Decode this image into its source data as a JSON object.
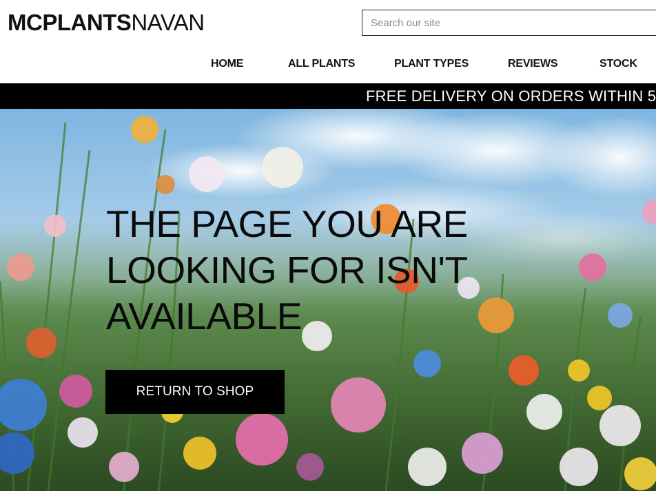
{
  "header": {
    "logo_bold": "MCPLANTS",
    "logo_light": "NAVAN",
    "search_placeholder": "Search our site"
  },
  "nav": {
    "items": [
      "HOME",
      "ALL PLANTS",
      "PLANT TYPES",
      "REVIEWS",
      "STOCK"
    ]
  },
  "banner": {
    "text": "FREE DELIVERY ON ORDERS WITHIN 5"
  },
  "hero": {
    "headline": "THE PAGE YOU ARE LOOKING FOR ISN'T AVAILABLE",
    "button_label": "RETURN TO SHOP"
  },
  "colors": {
    "brand_text": "#111111",
    "banner_bg": "#000000",
    "button_bg": "#000000",
    "button_text": "#ffffff"
  }
}
